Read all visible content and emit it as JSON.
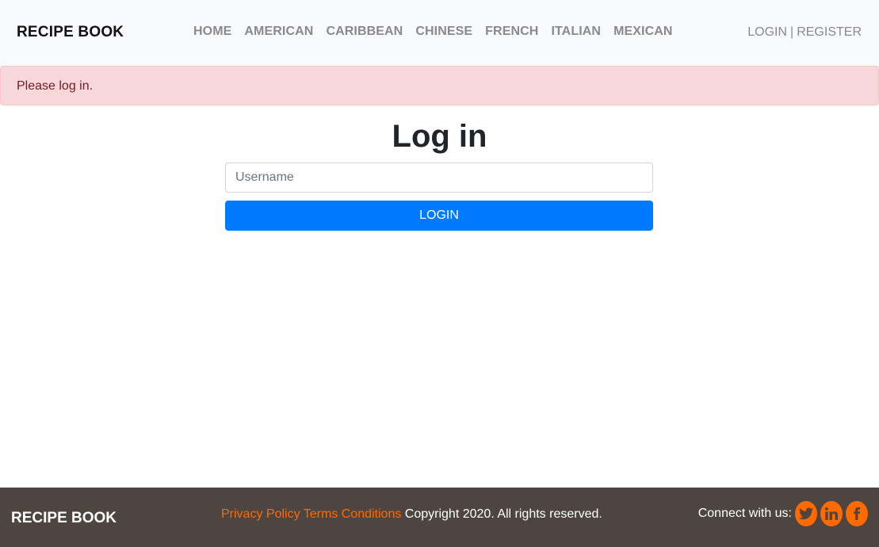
{
  "navbar": {
    "brand": "RECIPE BOOK",
    "links": [
      "HOME",
      "AMERICAN",
      "CARIBBEAN",
      "CHINESE",
      "FRENCH",
      "ITALIAN",
      "MEXICAN"
    ],
    "login_label": "LOGIN",
    "separator": "|",
    "register_label": "REGISTER"
  },
  "alert": {
    "message": "Please log in."
  },
  "main": {
    "title": "Log in",
    "username_placeholder": "Username",
    "username_value": "",
    "login_button_label": "LOGIN"
  },
  "footer": {
    "brand": "RECIPE BOOK",
    "privacy_label": "Privacy Policy",
    "terms_label": "Terms Conditions",
    "copyright": "Copyright 2020. All rights reserved.",
    "connect_label": "Connect with us:",
    "social_icons": [
      "twitter-icon",
      "linkedin-icon",
      "facebook-icon"
    ]
  },
  "colors": {
    "accent": "#ff6a00",
    "primary": "#007bff",
    "footer_bg": "#4e4540",
    "alert_bg": "#f8d7da"
  }
}
